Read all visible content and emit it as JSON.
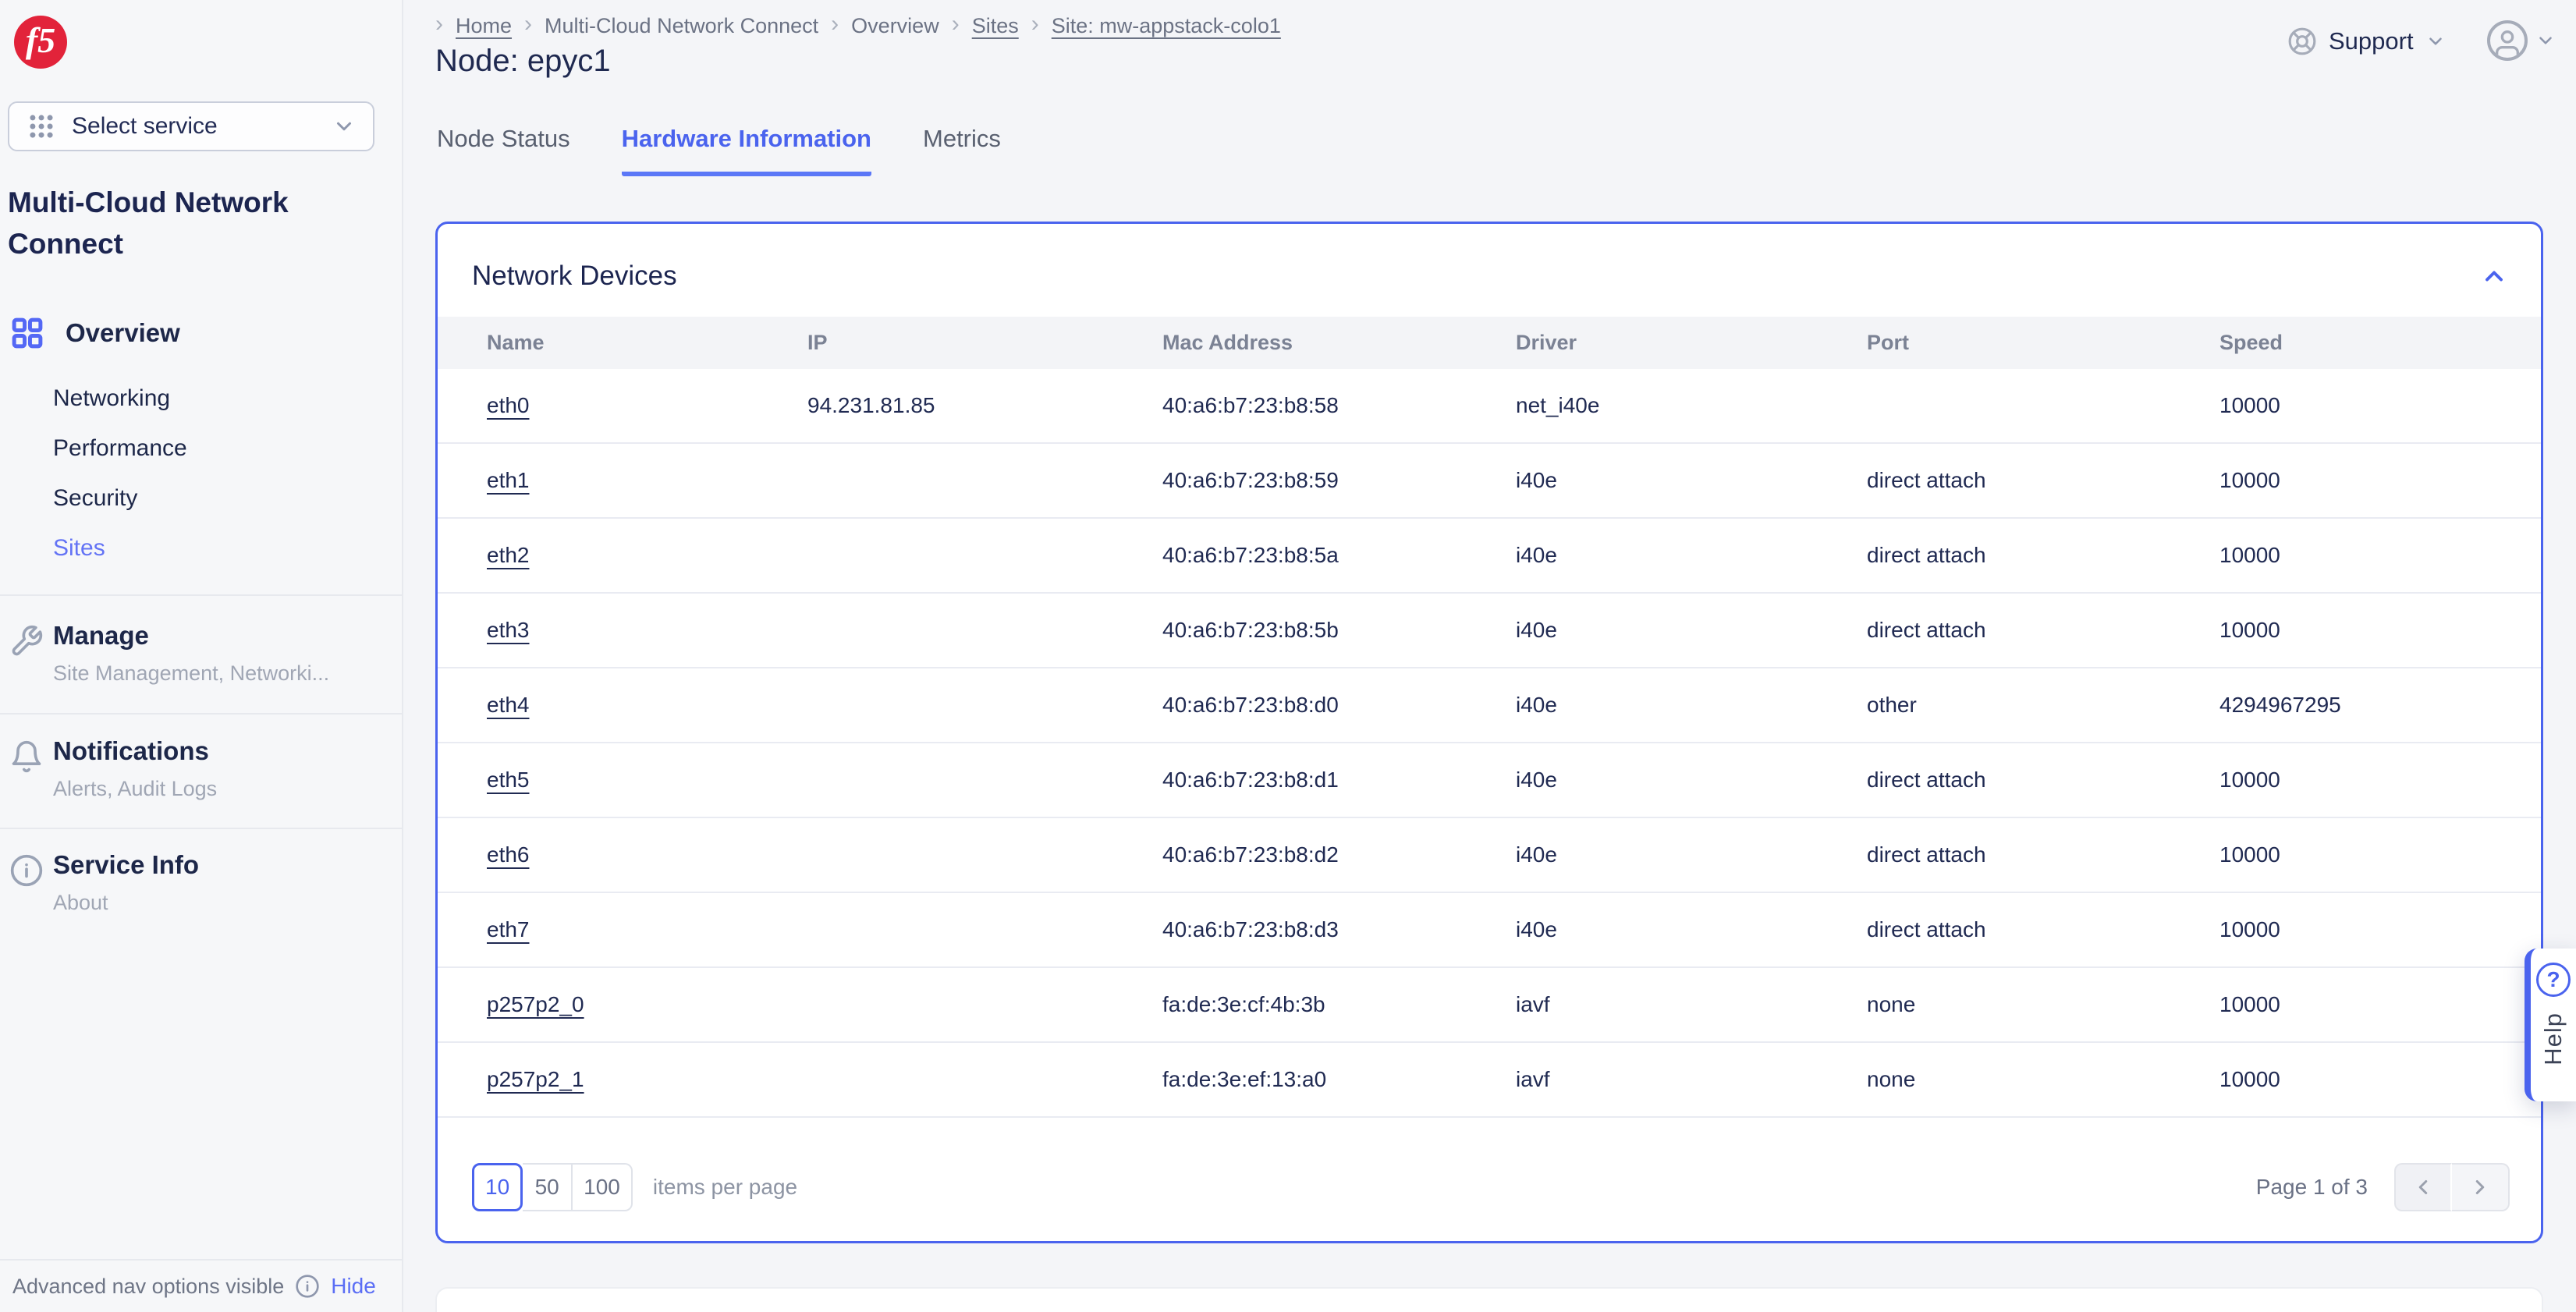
{
  "header": {
    "breadcrumb": [
      {
        "label": "Home",
        "link": true
      },
      {
        "label": "Multi-Cloud Network Connect",
        "link": false
      },
      {
        "label": "Overview",
        "link": false
      },
      {
        "label": "Sites",
        "link": true
      },
      {
        "label": "Site: mw-appstack-colo1",
        "link": true
      }
    ],
    "page_title": "Node: epyc1",
    "support_label": "Support"
  },
  "tabs": [
    {
      "label": "Node Status"
    },
    {
      "label": "Hardware Information"
    },
    {
      "label": "Metrics"
    }
  ],
  "sidebar": {
    "logo_text": "f5",
    "service_selector_label": "Select service",
    "service_title": "Multi-Cloud Network Connect",
    "overview_label": "Overview",
    "overview_children": [
      {
        "label": "Networking"
      },
      {
        "label": "Performance"
      },
      {
        "label": "Security"
      },
      {
        "label": "Sites",
        "active": true
      }
    ],
    "sections": [
      {
        "label": "Manage",
        "subtitle": "Site Management, Networki..."
      },
      {
        "label": "Notifications",
        "subtitle": "Alerts, Audit Logs"
      },
      {
        "label": "Service Info",
        "subtitle": "About"
      }
    ],
    "footer": {
      "text": "Advanced nav options visible",
      "action": "Hide"
    }
  },
  "card": {
    "title": "Network Devices",
    "table": {
      "columns": [
        "Name",
        "IP",
        "Mac Address",
        "Driver",
        "Port",
        "Speed"
      ],
      "rows": [
        {
          "name": "eth0",
          "ip": "94.231.81.85",
          "mac": "40:a6:b7:23:b8:58",
          "driver": "net_i40e",
          "port": "",
          "speed": "10000"
        },
        {
          "name": "eth1",
          "ip": "",
          "mac": "40:a6:b7:23:b8:59",
          "driver": "i40e",
          "port": "direct attach",
          "speed": "10000"
        },
        {
          "name": "eth2",
          "ip": "",
          "mac": "40:a6:b7:23:b8:5a",
          "driver": "i40e",
          "port": "direct attach",
          "speed": "10000"
        },
        {
          "name": "eth3",
          "ip": "",
          "mac": "40:a6:b7:23:b8:5b",
          "driver": "i40e",
          "port": "direct attach",
          "speed": "10000"
        },
        {
          "name": "eth4",
          "ip": "",
          "mac": "40:a6:b7:23:b8:d0",
          "driver": "i40e",
          "port": "other",
          "speed": "4294967295"
        },
        {
          "name": "eth5",
          "ip": "",
          "mac": "40:a6:b7:23:b8:d1",
          "driver": "i40e",
          "port": "direct attach",
          "speed": "10000"
        },
        {
          "name": "eth6",
          "ip": "",
          "mac": "40:a6:b7:23:b8:d2",
          "driver": "i40e",
          "port": "direct attach",
          "speed": "10000"
        },
        {
          "name": "eth7",
          "ip": "",
          "mac": "40:a6:b7:23:b8:d3",
          "driver": "i40e",
          "port": "direct attach",
          "speed": "10000"
        },
        {
          "name": "p257p2_0",
          "ip": "",
          "mac": "fa:de:3e:cf:4b:3b",
          "driver": "iavf",
          "port": "none",
          "speed": "10000"
        },
        {
          "name": "p257p2_1",
          "ip": "",
          "mac": "fa:de:3e:ef:13:a0",
          "driver": "iavf",
          "port": "none",
          "speed": "10000"
        }
      ]
    },
    "pagination": {
      "page_sizes": [
        "10",
        "50",
        "100"
      ],
      "selected_page_size": "10",
      "items_per_page_label": "items per page",
      "page_status": "Page 1 of 3"
    }
  },
  "help": {
    "label": "Help"
  },
  "colors": {
    "accent": "#4a63ee",
    "link_blue": "#6373f5",
    "navy": "#1c2550",
    "logo_red": "#e2233a",
    "header_row_bg": "#f3f4f7"
  }
}
